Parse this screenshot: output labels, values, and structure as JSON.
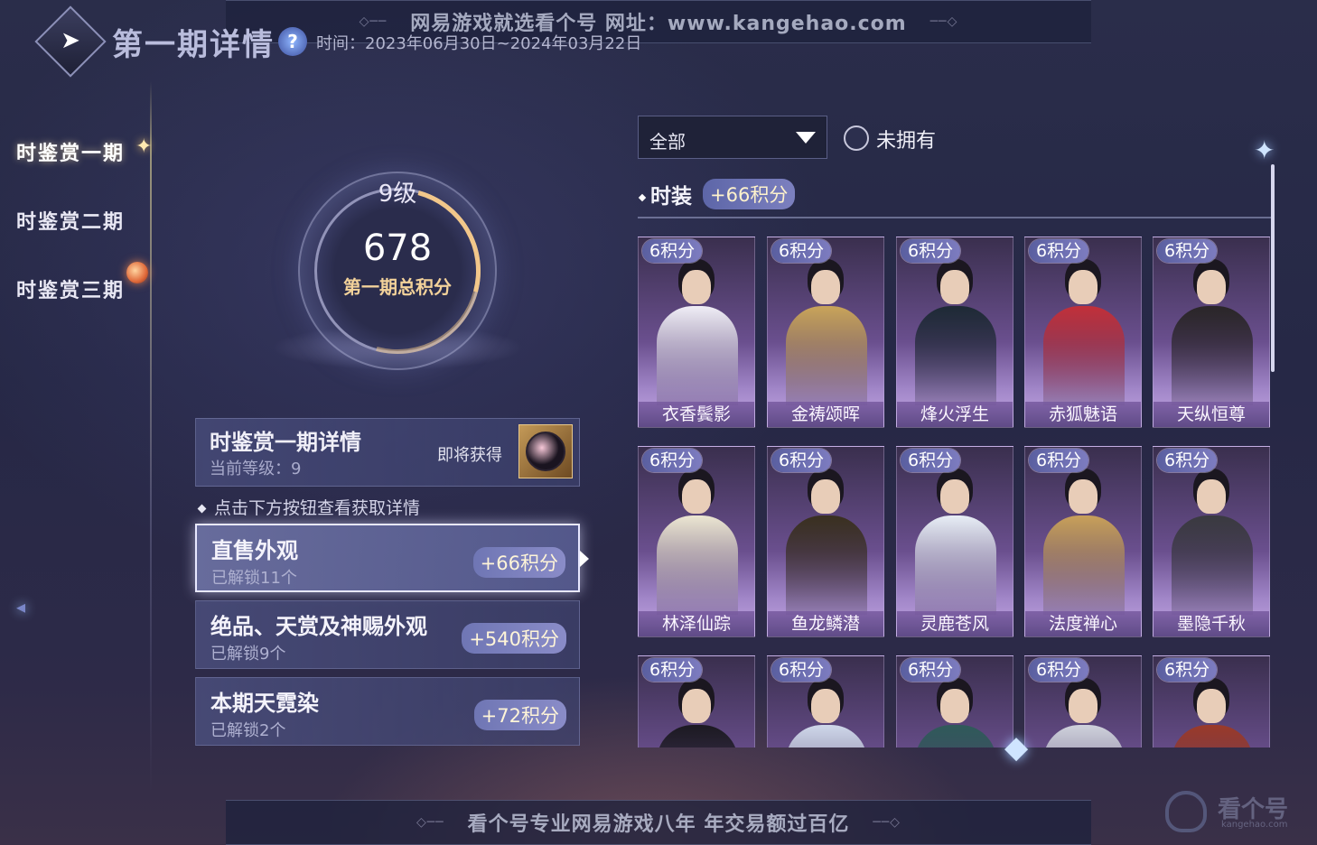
{
  "watermark": {
    "top_text": "网易游戏就选看个号   网址：www.kangehao.com",
    "bottom_text": "看个号专业网易游戏八年   年交易额过百亿",
    "corner_brand": "看个号",
    "corner_url": "kangehao.com"
  },
  "header": {
    "title": "第一期详情",
    "help": "?",
    "date_range": "时间：2023年06月30日~2024年03月22日"
  },
  "nav": {
    "items": [
      {
        "label": "时鉴赏一期",
        "active": true
      },
      {
        "label": "时鉴赏二期",
        "active": false
      },
      {
        "label": "时鉴赏三期",
        "active": false
      }
    ]
  },
  "level": {
    "level_text": "9级",
    "level_value": 9,
    "total_score": "678",
    "score_label": "第一期总积分"
  },
  "detail": {
    "title": "时鉴赏一期详情",
    "current_level": "当前等级：9",
    "soon_label": "即将获得"
  },
  "tip": "点击下方按钮查看获取详情",
  "categories": [
    {
      "title": "直售外观",
      "sub": "已解锁11个",
      "badge": "+66积分",
      "active": true
    },
    {
      "title": "绝品、天赏及神赐外观",
      "sub": "已解锁9个",
      "badge": "+540积分",
      "active": false
    },
    {
      "title": "本期天霓染",
      "sub": "已解锁2个",
      "badge": "+72积分",
      "active": false
    }
  ],
  "filter": {
    "selected": "全部",
    "radio_label": "未拥有"
  },
  "section": {
    "title": "时装",
    "badge": "+66积分"
  },
  "outfits": [
    {
      "name": "衣香鬓影",
      "points": "6积分",
      "accent": "#f0eef6"
    },
    {
      "name": "金祷颂晖",
      "points": "6积分",
      "accent": "#c9a45a"
    },
    {
      "name": "烽火浮生",
      "points": "6积分",
      "accent": "#1e2a36"
    },
    {
      "name": "赤狐魅语",
      "points": "6积分",
      "accent": "#c2303a"
    },
    {
      "name": "天纵恒尊",
      "points": "6积分",
      "accent": "#2a2628"
    },
    {
      "name": "林泽仙踪",
      "points": "6积分",
      "accent": "#ece6d2"
    },
    {
      "name": "鱼龙鳞潜",
      "points": "6积分",
      "accent": "#3a3020"
    },
    {
      "name": "灵鹿苍风",
      "points": "6积分",
      "accent": "#e8eef6"
    },
    {
      "name": "法度禅心",
      "points": "6积分",
      "accent": "#c8a05a"
    },
    {
      "name": "墨隐千秋",
      "points": "6积分",
      "accent": "#3a3a40"
    },
    {
      "name": "",
      "points": "6积分",
      "accent": "#1c1a22"
    },
    {
      "name": "",
      "points": "6积分",
      "accent": "#cfd8ea"
    },
    {
      "name": "",
      "points": "6积分",
      "accent": "#2f5a5a"
    },
    {
      "name": "",
      "points": "6积分",
      "accent": "#cfd2dc"
    },
    {
      "name": "",
      "points": "6积分",
      "accent": "#9a3a2a"
    }
  ]
}
